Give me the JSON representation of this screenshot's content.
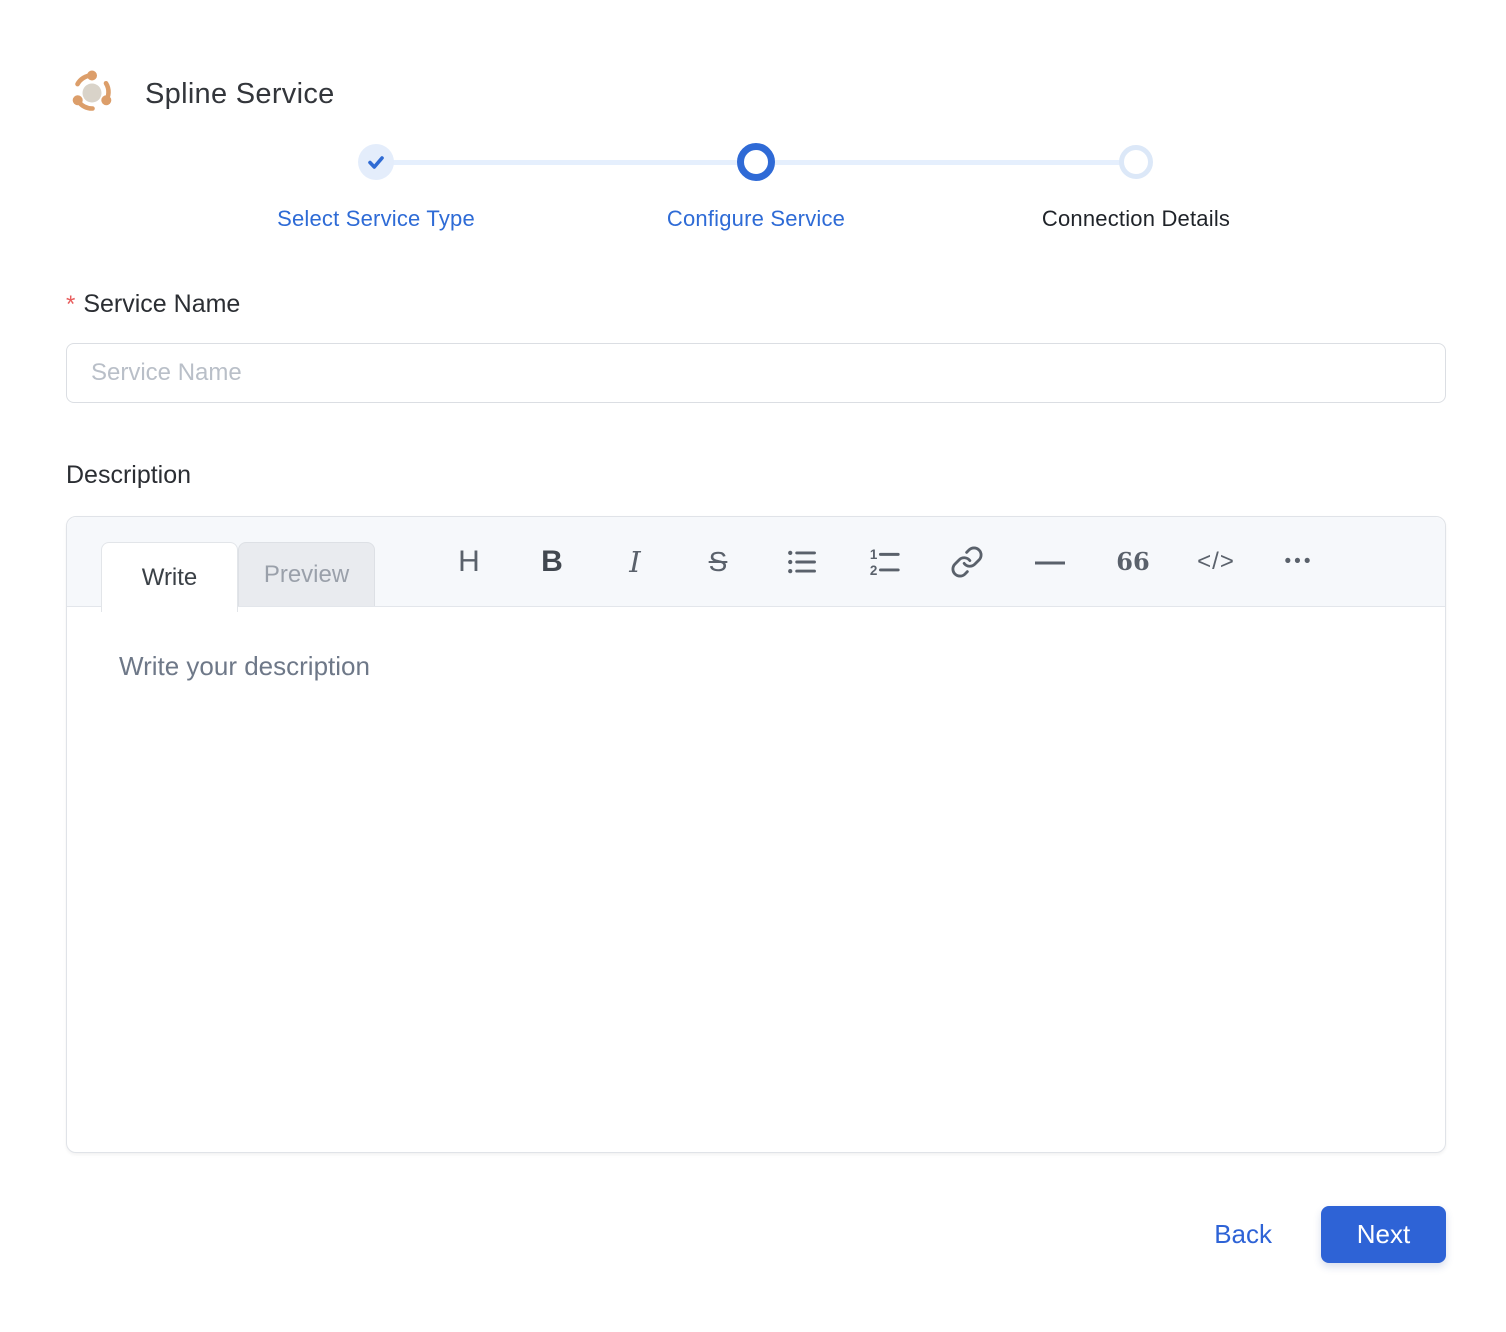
{
  "app": {
    "title": "Spline Service",
    "logo_icon": "spline-service-logo",
    "logo_color": "#dc9e6a"
  },
  "colors": {
    "accent_blue": "#2e63d6",
    "step_ring_blue": "#2f6ad6",
    "step_done_bg": "#e4edfb",
    "connector_line": "#e5effd",
    "toolbar_icon": "#5a616b",
    "required_red": "#e85d5d"
  },
  "stepper": {
    "steps": [
      {
        "label": "Select Service Type",
        "state": "completed"
      },
      {
        "label": "Configure Service",
        "state": "current"
      },
      {
        "label": "Connection Details",
        "state": "pending"
      }
    ]
  },
  "form": {
    "service_name": {
      "required_marker": "*",
      "label": "Service Name",
      "placeholder": "Service Name",
      "value": ""
    },
    "description": {
      "label": "Description",
      "editor": {
        "tabs": [
          {
            "label": "Write",
            "active": true
          },
          {
            "label": "Preview",
            "active": false
          }
        ],
        "toolbar": [
          {
            "name": "heading-icon",
            "glyph": "H"
          },
          {
            "name": "bold-icon",
            "glyph": "B"
          },
          {
            "name": "italic-icon",
            "glyph": "I"
          },
          {
            "name": "strikethrough-icon",
            "glyph": "S"
          },
          {
            "name": "unordered-list-icon",
            "glyph": ""
          },
          {
            "name": "ordered-list-icon",
            "glyph": ""
          },
          {
            "name": "link-icon",
            "glyph": ""
          },
          {
            "name": "horizontal-rule-icon",
            "glyph": "—"
          },
          {
            "name": "quote-icon",
            "glyph": "66"
          },
          {
            "name": "code-icon",
            "glyph": "</>"
          },
          {
            "name": "more-icon",
            "glyph": "•••"
          }
        ],
        "placeholder": "Write your description",
        "value": ""
      }
    }
  },
  "footer": {
    "back_label": "Back",
    "next_label": "Next"
  }
}
